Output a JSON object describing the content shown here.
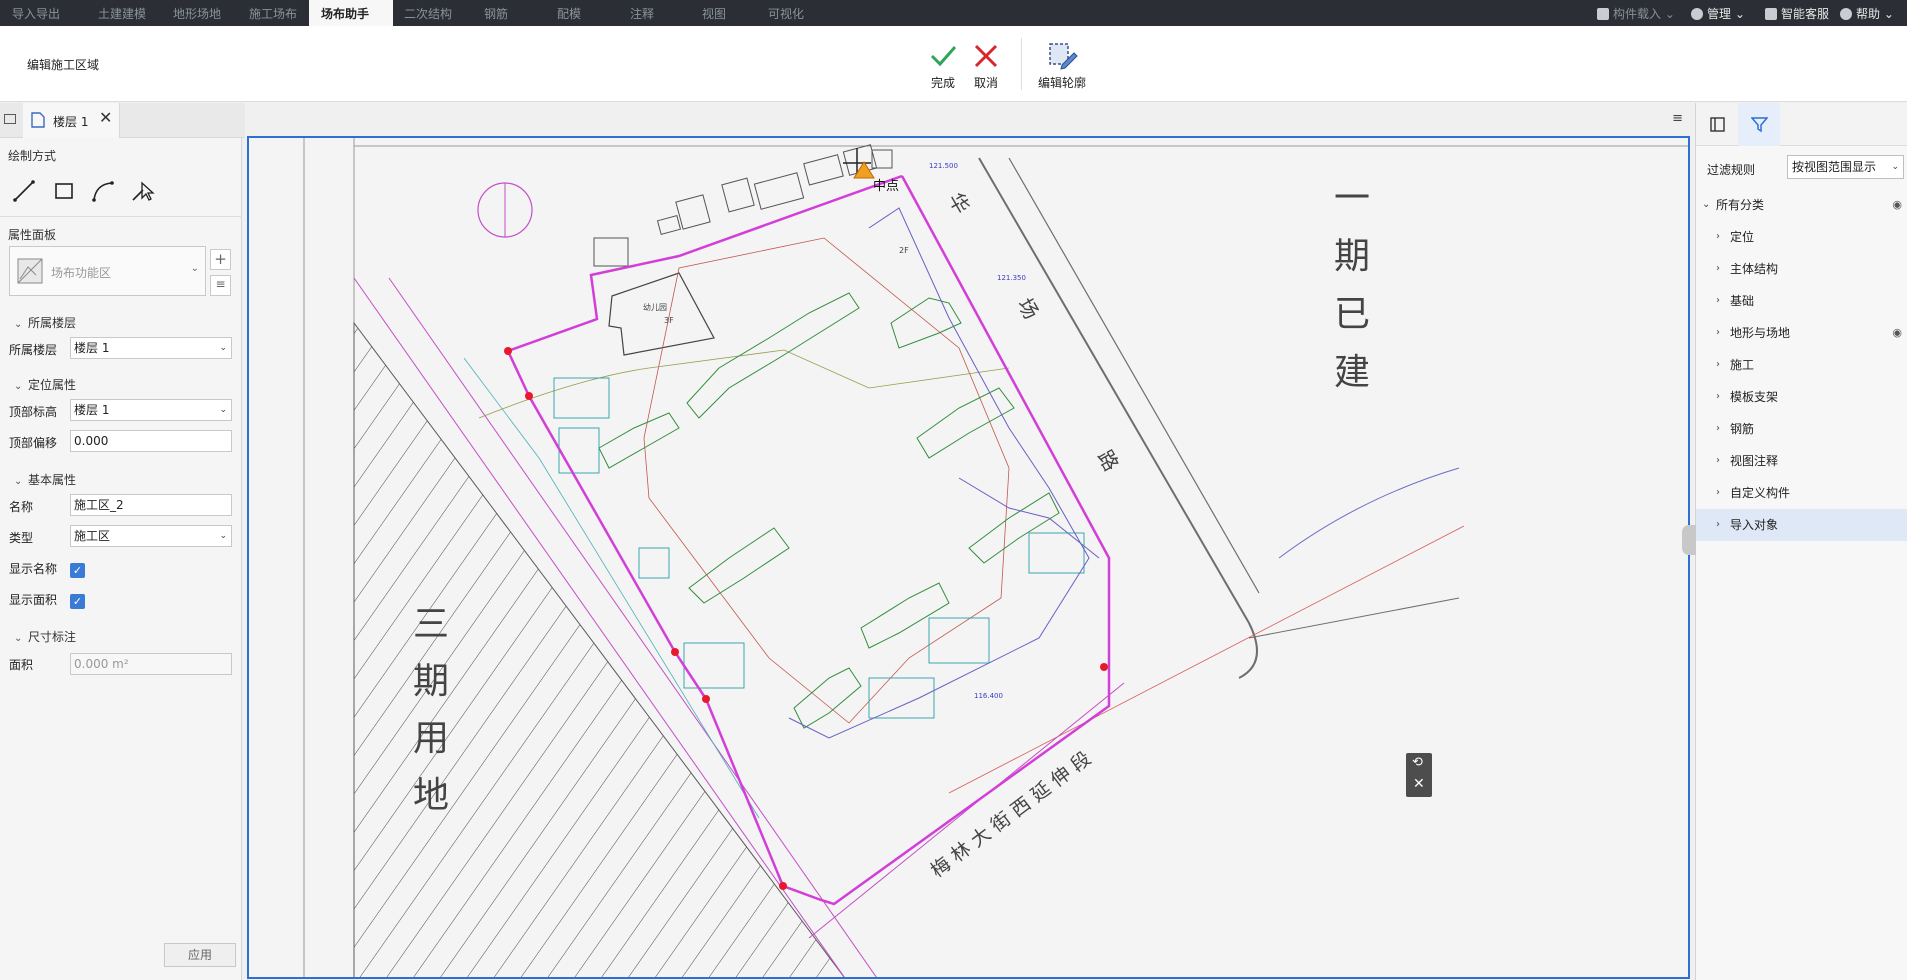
{
  "top_tabs": [
    "导入导出",
    "土建建模",
    "地形场地",
    "施工场布",
    "场布助手",
    "二次结构",
    "钢筋",
    "配模",
    "注释",
    "视图",
    "可视化"
  ],
  "active_tab_index": 4,
  "top_right": {
    "component_import": "构件载入",
    "manage": "管理",
    "smart_service": "智能客服",
    "help": "帮助"
  },
  "ribbon": {
    "title": "编辑施工区域",
    "done": "完成",
    "cancel": "取消",
    "edit_outline": "编辑轮廓"
  },
  "doc_tab": {
    "label": "楼层 1"
  },
  "left_panel": {
    "draw_method": "绘制方式",
    "prop_panel": "属性面板",
    "family_placeholder": "场布功能区",
    "groups": {
      "floor": "所属楼层",
      "position": "定位属性",
      "basic": "基本属性",
      "dimension": "尺寸标注"
    },
    "props": {
      "floor_label": "所属楼层",
      "floor_value": "楼层 1",
      "top_elev_label": "顶部标高",
      "top_elev_value": "楼层 1",
      "top_offset_label": "顶部偏移",
      "top_offset_value": "0.000",
      "name_label": "名称",
      "name_value": "施工区_2",
      "type_label": "类型",
      "type_value": "施工区",
      "show_name_label": "显示名称",
      "show_area_label": "显示面积",
      "area_label": "面积",
      "area_value": "0.000 m²"
    },
    "apply": "应用"
  },
  "right_panel": {
    "filter_rule_label": "过滤规则",
    "filter_rule_value": "按视图范围显示",
    "tree_root": "所有分类",
    "tree_items": [
      "定位",
      "主体结构",
      "基础",
      "地形与场地",
      "施工",
      "模板支架",
      "钢筋",
      "视图注释",
      "自定义构件",
      "导入对象"
    ],
    "selected_index": 9
  },
  "canvas": {
    "snap_label": "中点",
    "text_phase1": [
      "一",
      "期",
      "已",
      "建"
    ],
    "text_phase3": [
      "三",
      "期",
      "用",
      "地"
    ],
    "road_right": [
      "华",
      "场",
      "路"
    ],
    "road_bottom": "梅 林 大 街 西 延 伸 段",
    "kindergarten": "幼儿园",
    "floors_2f": "2F",
    "floors_3f": "3F",
    "elev_top": "121.500",
    "elev_right": "121.350",
    "elev_bottom": "116.400"
  },
  "colors": {
    "accent": "#2d6fd6",
    "boundary": "#d23ed8",
    "vertex": "#e8192c",
    "done_green": "#2fa55a",
    "cancel_red": "#d9262c"
  }
}
